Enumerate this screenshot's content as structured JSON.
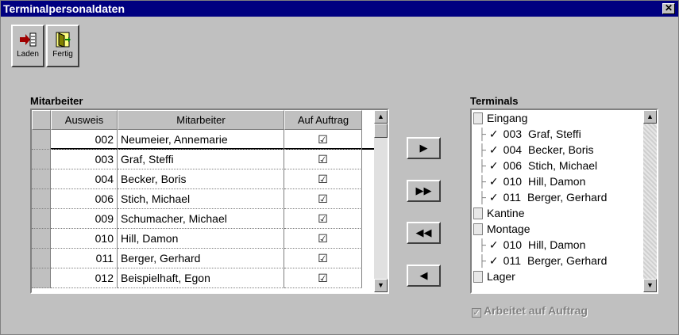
{
  "window": {
    "title": "Terminalpersonaldaten",
    "close_glyph": "✕"
  },
  "toolbar": {
    "load_label": "Laden",
    "done_label": "Fertig"
  },
  "staff": {
    "section_label": "Mitarbeiter",
    "columns": [
      "Ausweis",
      "Mitarbeiter",
      "Auf Auftrag"
    ],
    "rows": [
      {
        "id": "002",
        "name": "Neumeier, Annemarie",
        "checked": "☑"
      },
      {
        "id": "003",
        "name": "Graf, Steffi",
        "checked": "☑"
      },
      {
        "id": "004",
        "name": "Becker, Boris",
        "checked": "☑"
      },
      {
        "id": "006",
        "name": "Stich, Michael",
        "checked": "☑"
      },
      {
        "id": "009",
        "name": "Schumacher, Michael",
        "checked": "☑"
      },
      {
        "id": "010",
        "name": "Hill, Damon",
        "checked": "☑"
      },
      {
        "id": "011",
        "name": "Berger, Gerhard",
        "checked": "☑"
      },
      {
        "id": "012",
        "name": "Beispielhaft, Egon",
        "checked": "☑"
      }
    ]
  },
  "buttons": {
    "add_one": "▶",
    "add_all": "▶▶",
    "remove_all": "◀◀",
    "remove_one": "◀"
  },
  "terminals": {
    "section_label": "Terminals",
    "items": [
      {
        "type": "terminal",
        "label": "Eingang"
      },
      {
        "type": "person",
        "id": "003",
        "name": "Graf, Steffi"
      },
      {
        "type": "person",
        "id": "004",
        "name": "Becker, Boris"
      },
      {
        "type": "person",
        "id": "006",
        "name": "Stich, Michael"
      },
      {
        "type": "person",
        "id": "010",
        "name": "Hill, Damon"
      },
      {
        "type": "person",
        "id": "011",
        "name": "Berger, Gerhard"
      },
      {
        "type": "terminal",
        "label": "Kantine"
      },
      {
        "type": "terminal",
        "label": "Montage"
      },
      {
        "type": "person",
        "id": "010",
        "name": "Hill, Damon"
      },
      {
        "type": "person",
        "id": "011",
        "name": "Berger, Gerhard"
      },
      {
        "type": "terminal",
        "label": "Lager"
      }
    ]
  },
  "footer": {
    "checkbox_label": "Arbeitet auf Auftrag"
  },
  "colors": {
    "titlebar": "#000080",
    "face": "#c0c0c0"
  }
}
